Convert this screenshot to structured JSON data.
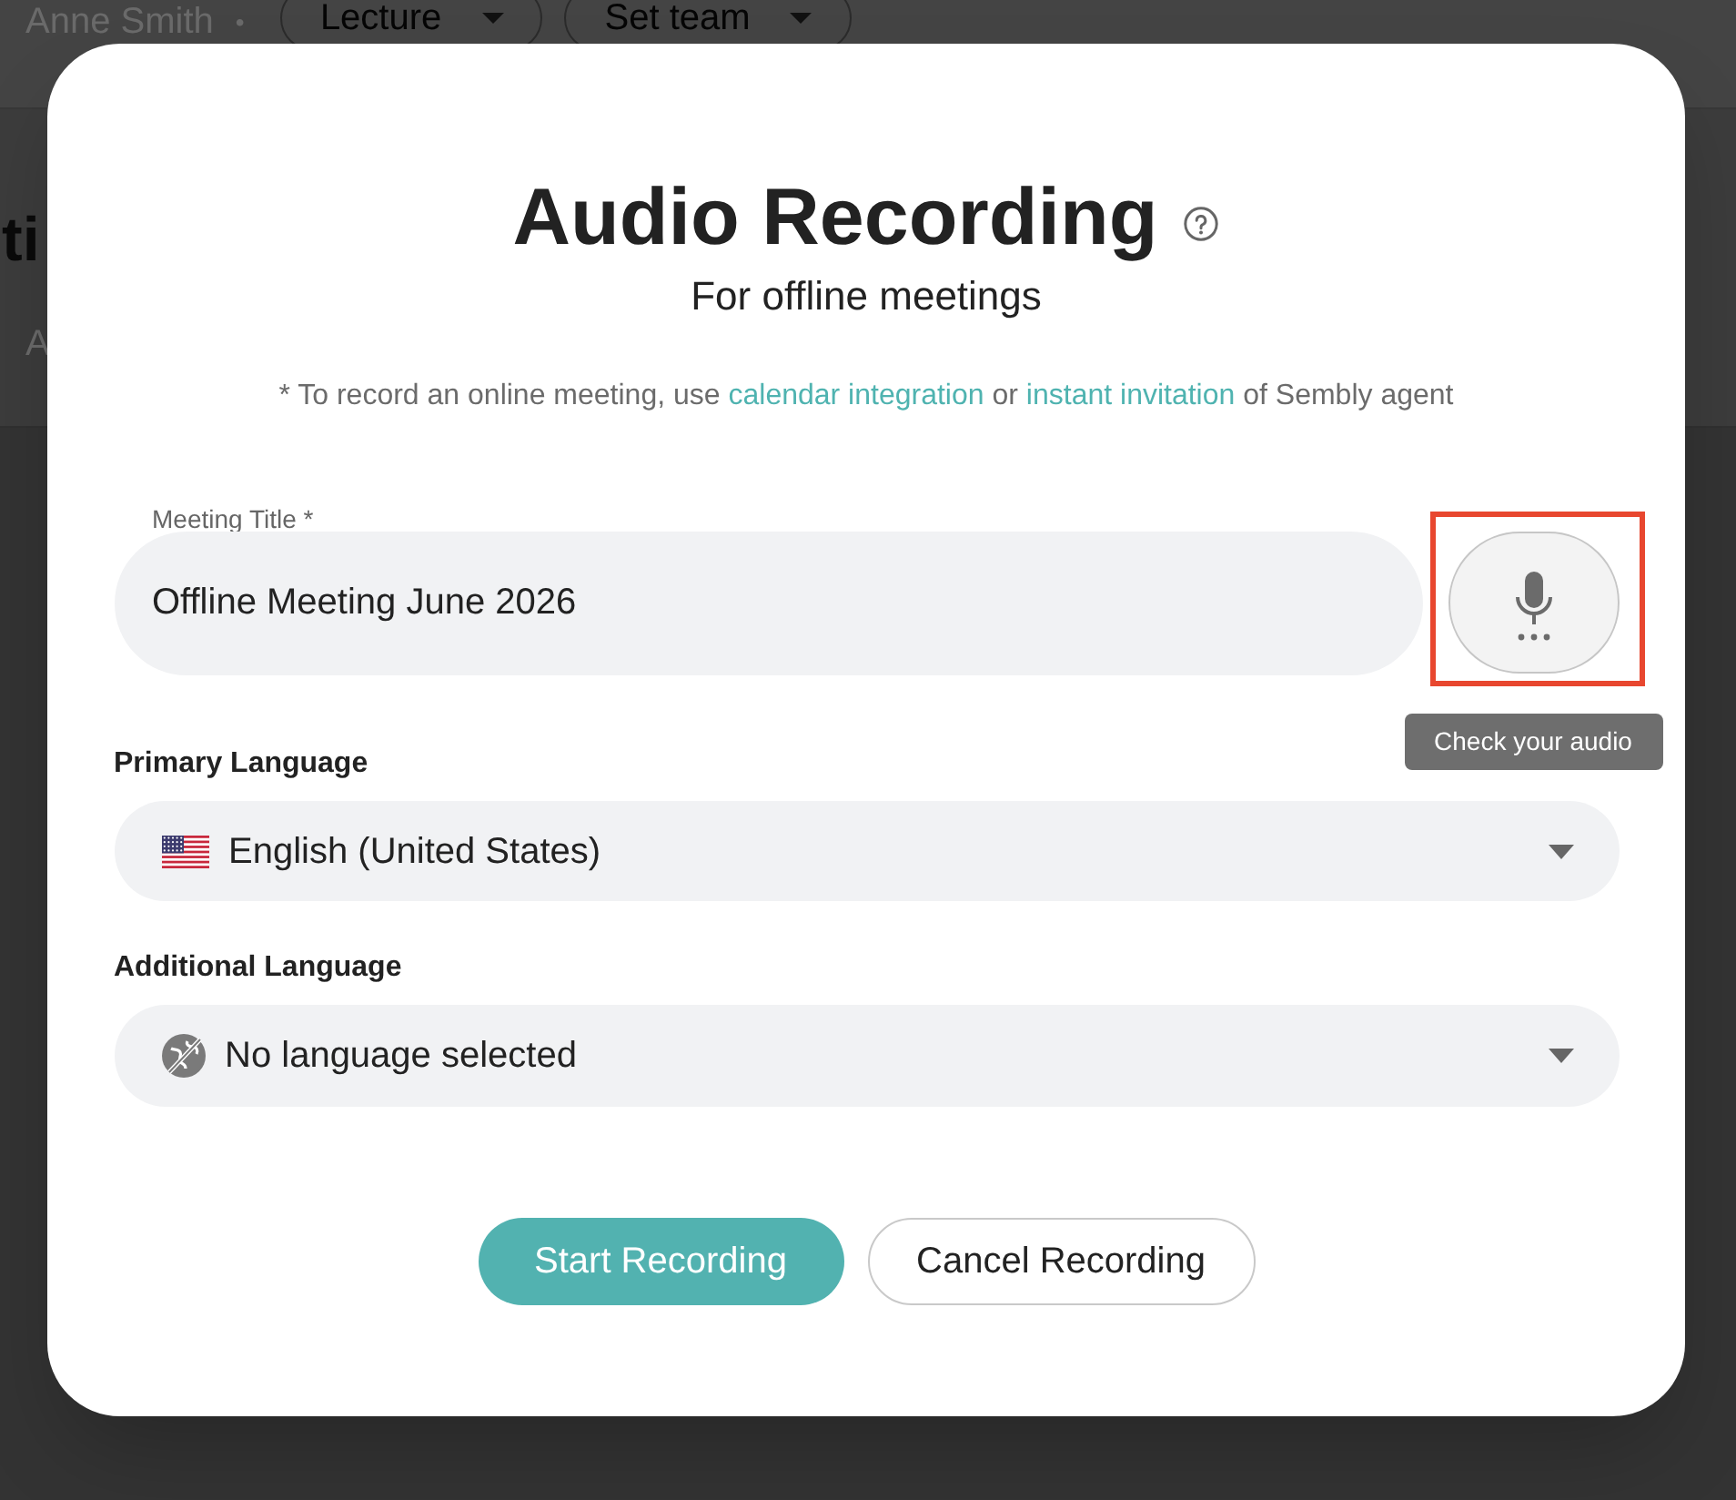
{
  "background_page": {
    "user_name": "Anne Smith",
    "separator": "•",
    "filters": [
      {
        "label": "Lecture"
      },
      {
        "label": "Set team"
      }
    ],
    "heading": "ti",
    "tab": "A"
  },
  "dialog": {
    "title": "Audio Recording",
    "subtitle": "For offline meetings",
    "note": [
      {
        "kind": "text",
        "text": "* To record an online meeting, use"
      },
      {
        "kind": "link",
        "text": "calendar integration"
      },
      {
        "kind": "text",
        "text": "or"
      },
      {
        "kind": "link",
        "text": "instant invitation"
      },
      {
        "kind": "text",
        "text": "of Sembly agent"
      }
    ],
    "meeting_title": {
      "label": "Meeting Title *",
      "value": "Offline Meeting June 2026"
    },
    "mic_button": {
      "highlighted": true,
      "tooltip": "Check your audio"
    },
    "languages": [
      {
        "label": "Primary Language",
        "value": "English (United States)",
        "kind": "flag"
      },
      {
        "label": "Additional Language",
        "value": "No language selected",
        "kind": "none"
      }
    ],
    "buttons": [
      {
        "label": "Start Recording",
        "kind": "primary"
      },
      {
        "label": "Cancel Recording",
        "kind": "secondary"
      }
    ]
  }
}
